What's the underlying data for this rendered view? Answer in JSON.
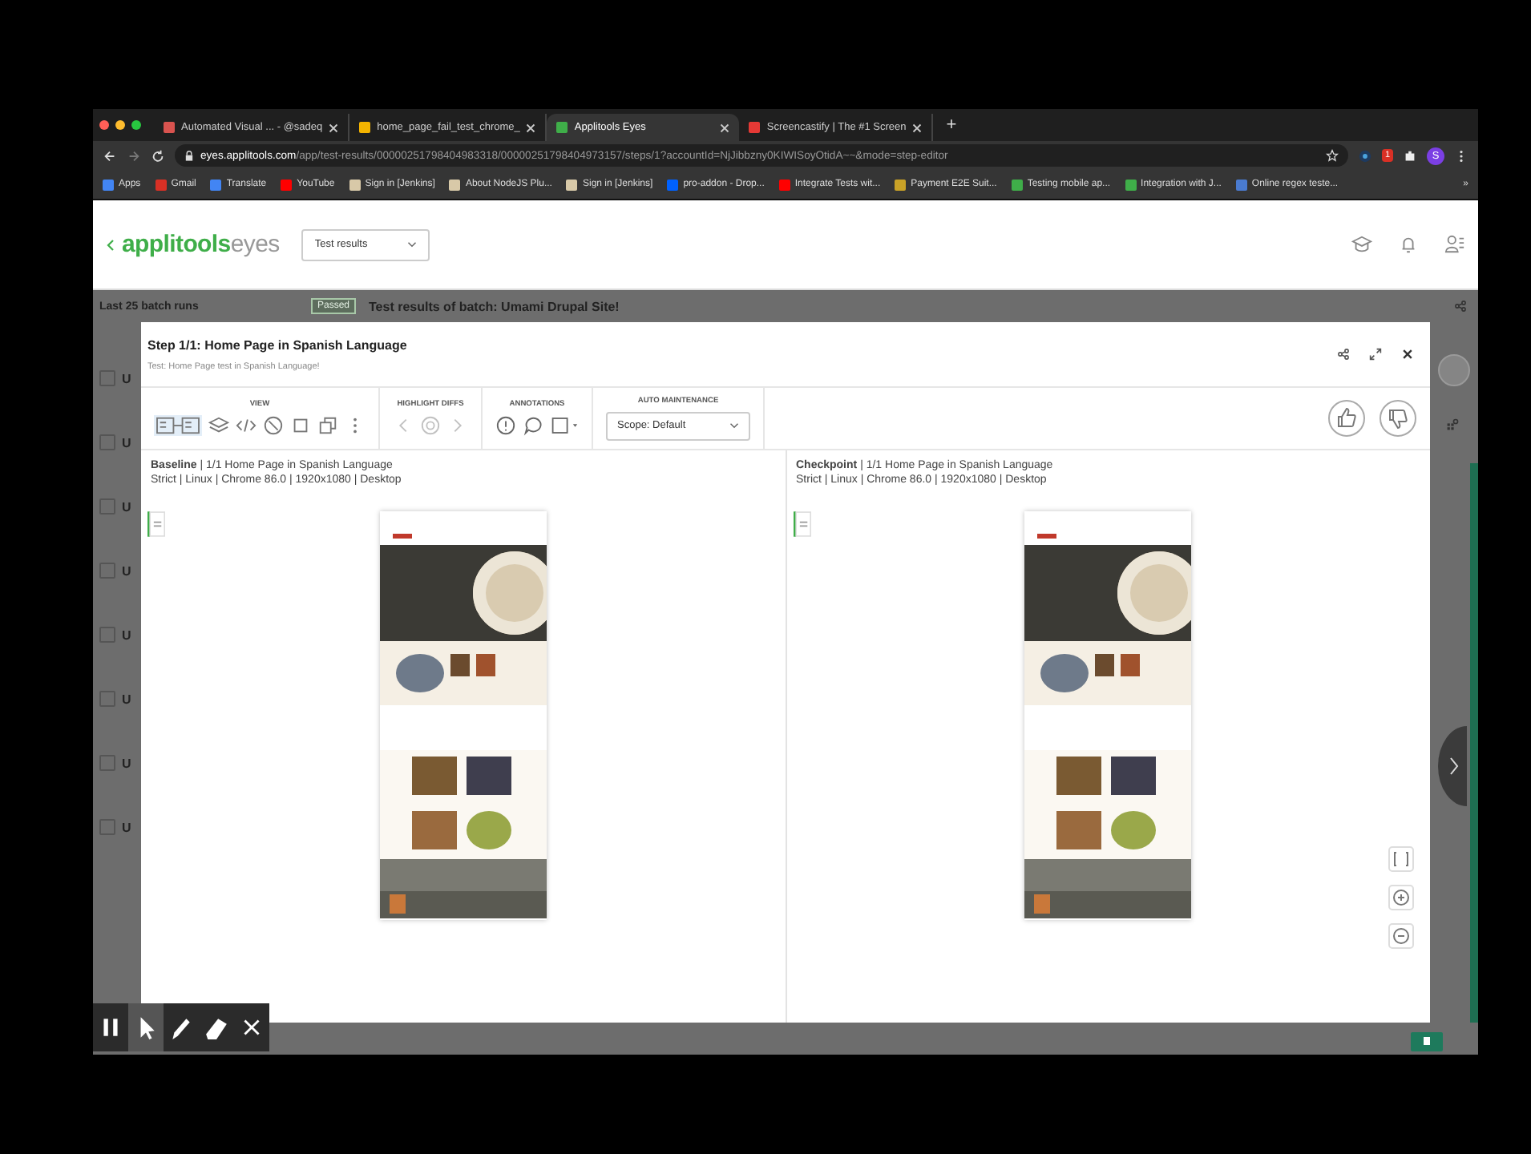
{
  "browser": {
    "tabs": [
      {
        "title": "Automated Visual ... - @sadeq",
        "selected": false
      },
      {
        "title": "home_page_fail_test_chrome_",
        "selected": false
      },
      {
        "title": "Applitools Eyes",
        "selected": true
      },
      {
        "title": "Screencastify | The #1 Screen",
        "selected": false
      }
    ],
    "new_tab": "+",
    "url_host": "eyes.applitools.com",
    "url_path": "/app/test-results/00000251798404983318/00000251798404973157/steps/1?accountId=NjJibbzny0KIWISoyOtidA~~&mode=step-editor",
    "extension_badge": "1",
    "profile_initial": "S",
    "bookmarks": [
      {
        "label": "Apps",
        "color": "#4285f4"
      },
      {
        "label": "Gmail",
        "color": "#d93025"
      },
      {
        "label": "Translate",
        "color": "#4285f4"
      },
      {
        "label": "YouTube",
        "color": "#ff0000"
      },
      {
        "label": "Sign in [Jenkins]",
        "color": "#d8c9a8"
      },
      {
        "label": "About NodeJS Plu...",
        "color": "#d8c9a8"
      },
      {
        "label": "Sign in [Jenkins]",
        "color": "#d8c9a8"
      },
      {
        "label": "pro-addon - Drop...",
        "color": "#0061fe"
      },
      {
        "label": "Integrate Tests wit...",
        "color": "#ff0000"
      },
      {
        "label": "Payment E2E Suit...",
        "color": "#c9a227"
      },
      {
        "label": "Testing mobile ap...",
        "color": "#3fae49"
      },
      {
        "label": "Integration with J...",
        "color": "#3fae49"
      },
      {
        "label": "Online regex teste...",
        "color": "#4a7bd0"
      }
    ],
    "more_bookmarks": "»"
  },
  "app": {
    "logo_bold": "applitools",
    "logo_light": "eyes",
    "view_select": "Test results"
  },
  "batch": {
    "heading": "Last 25 batch runs",
    "status": "Passed",
    "title": "Test results of batch: Umami Drupal Site!",
    "rows": [
      {
        "label": "U",
        "checked": false
      },
      {
        "label": "U",
        "checked": false
      },
      {
        "label": "U",
        "checked": false
      },
      {
        "label": "U",
        "checked": false
      },
      {
        "label": "U",
        "checked": false
      },
      {
        "label": "U",
        "checked": false
      },
      {
        "label": "U",
        "checked": false
      },
      {
        "label": "U",
        "checked": false
      }
    ]
  },
  "dialog": {
    "title": "Step 1/1: Home Page in Spanish Language",
    "subtitle": "Test: Home Page test in Spanish Language!",
    "view": {
      "label": "VIEW",
      "tools": [
        {
          "kind": "side-by-side",
          "selected": true
        },
        {
          "kind": "layers",
          "selected": false
        },
        {
          "kind": "code",
          "selected": false
        },
        {
          "kind": "ignore",
          "selected": false
        },
        {
          "kind": "crop",
          "selected": false
        },
        {
          "kind": "copy",
          "selected": false
        },
        {
          "kind": "more",
          "selected": false
        }
      ]
    },
    "highlight": {
      "label": "HIGHLIGHT DIFFS",
      "disabled": true
    },
    "annotations": {
      "label": "ANNOTATIONS"
    },
    "maintenance": {
      "label": "AUTO MAINTENANCE",
      "scope": "Scope: Default"
    },
    "panes": [
      {
        "title": "**Baseline** | 1/1 Home Page in Spanish Language",
        "meta": "Strict | Linux | Chrome 86.0 | 1920x1080 | Desktop"
      },
      {
        "title": "**Checkpoint** | 1/1 Home Page in Spanish Language",
        "meta": "Strict | Linux | Chrome 86.0 | 1920x1080 | Desktop"
      }
    ]
  },
  "recorder": {
    "tools": [
      {
        "kind": "pause",
        "selected": false
      },
      {
        "kind": "pointer",
        "selected": true
      },
      {
        "kind": "pen",
        "selected": false
      },
      {
        "kind": "eraser",
        "selected": false
      },
      {
        "kind": "close",
        "selected": false
      }
    ]
  }
}
